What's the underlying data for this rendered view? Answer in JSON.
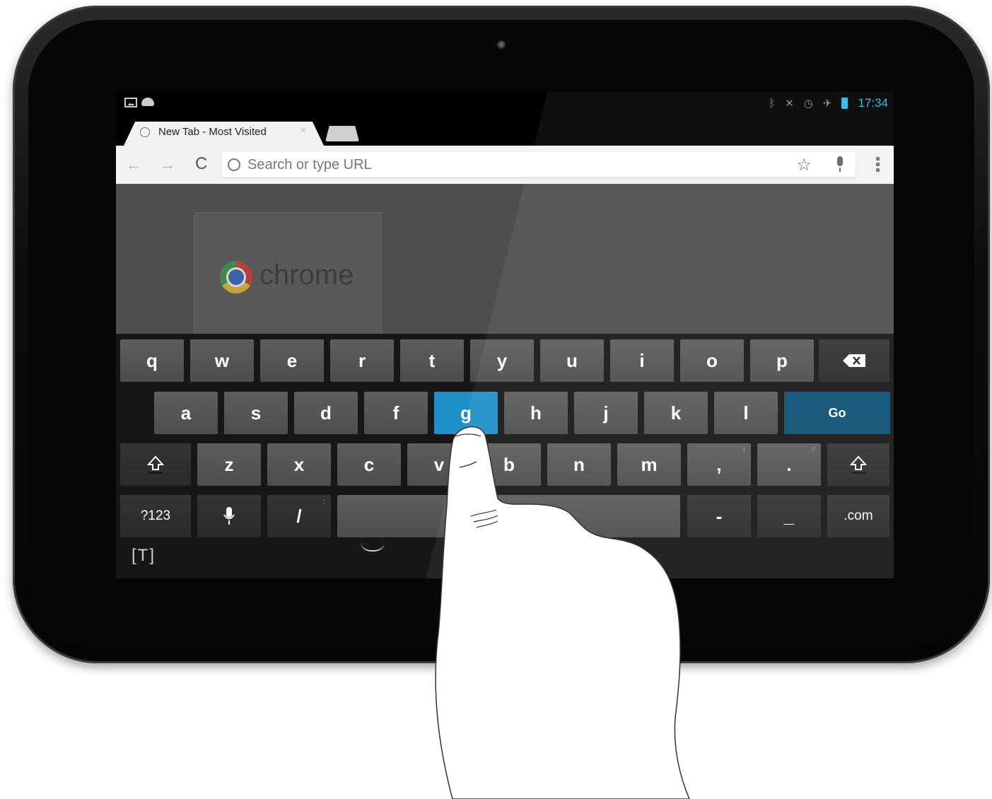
{
  "status_bar": {
    "time": "17:34",
    "left_icons": [
      "gallery-icon",
      "android-icon"
    ],
    "right_icons": [
      "bluetooth-icon",
      "mute-icon",
      "alarm-icon",
      "airplane-icon",
      "battery-icon"
    ]
  },
  "tab": {
    "title": "New Tab - Most Visited",
    "close": "×"
  },
  "toolbar": {
    "back": "←",
    "forward": "→",
    "reload": "C",
    "omnibox_placeholder": "Search or type URL",
    "star": "☆"
  },
  "content": {
    "thumbnail_title": "chrome"
  },
  "keyboard": {
    "row1": [
      "q",
      "w",
      "e",
      "r",
      "t",
      "y",
      "u",
      "i",
      "o",
      "p"
    ],
    "row2": [
      "a",
      "s",
      "d",
      "f",
      "g",
      "h",
      "j",
      "k",
      "l"
    ],
    "go": "Go",
    "row3": [
      "z",
      "x",
      "c",
      "v",
      "b",
      "n",
      "m"
    ],
    "comma": ",",
    "comma_hint": "!",
    "period": ".",
    "period_hint": "?",
    "numbers": "?123",
    "slash": "/",
    "slash_hint": ":",
    "dash": "-",
    "underscore": "_",
    "dotcom": ".com",
    "footer_t": "[T]",
    "pressed_key": "g"
  },
  "colors": {
    "accent": "#33b5e5",
    "pressed_key": "#1e8fc7",
    "go_key": "#0e5175"
  }
}
